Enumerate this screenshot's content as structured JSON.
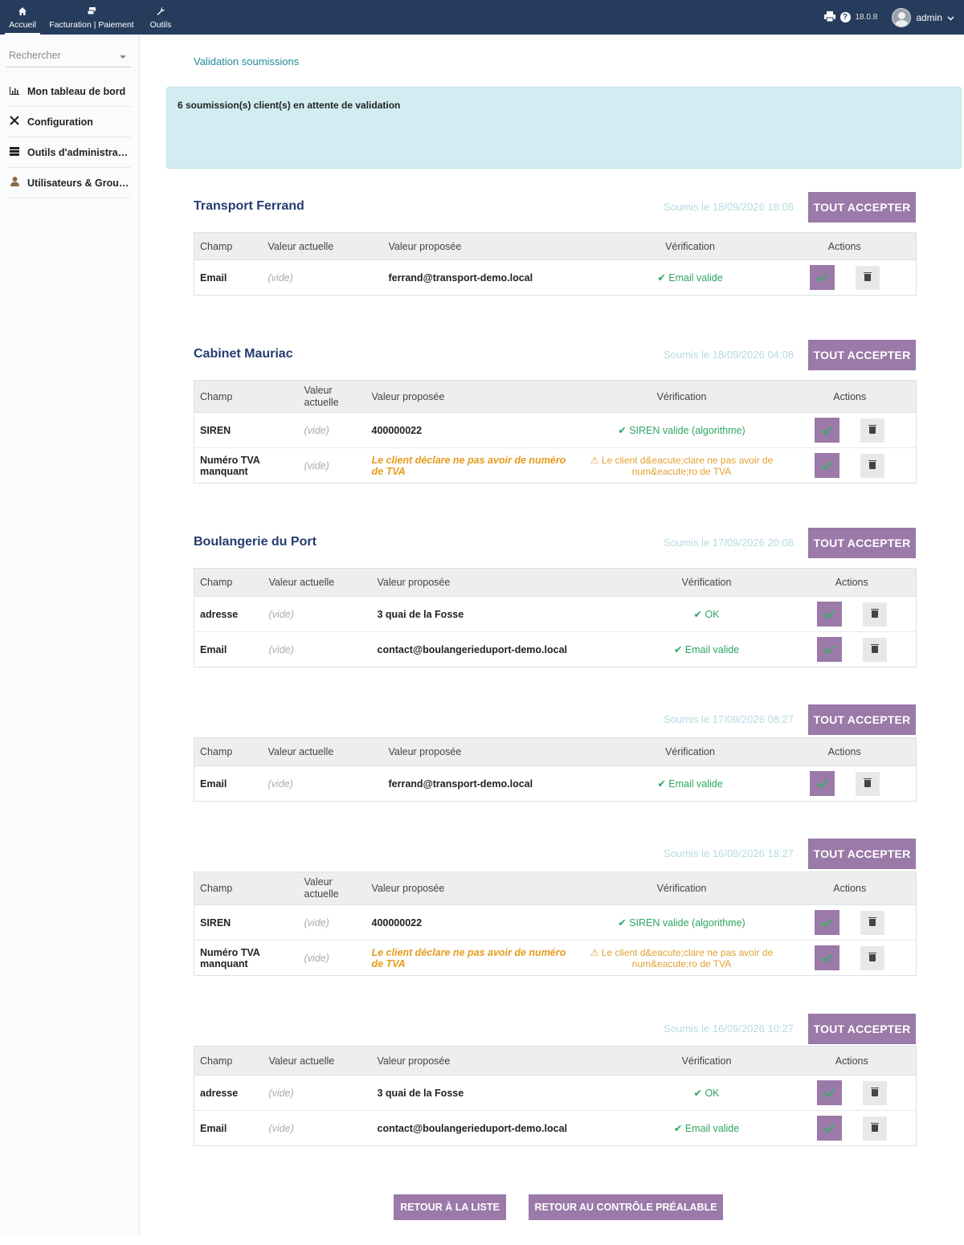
{
  "topbar": {
    "menus": [
      {
        "label": "Accueil",
        "icon": "home-icon"
      },
      {
        "label": "Facturation | Paiement",
        "icon": "billing-icon"
      },
      {
        "label": "Outils",
        "icon": "wrench-icon"
      }
    ],
    "version": "18.0.8",
    "user": "admin"
  },
  "sidebar": {
    "search_placeholder": "Rechercher",
    "items": [
      {
        "label": "Mon tableau de bord",
        "icon": "chart-icon"
      },
      {
        "label": "Configuration",
        "icon": "tools-icon"
      },
      {
        "label": "Outils d'administration",
        "icon": "server-icon"
      },
      {
        "label": "Utilisateurs & Groupes",
        "icon": "user-icon"
      }
    ]
  },
  "breadcrumb": "Validation soumissions",
  "alert": "6 soumission(s) client(s) en attente de validation",
  "accept_all_label": "TOUT ACCEPTER",
  "columns": {
    "field": "Champ",
    "current": "Valeur actuelle",
    "proposed": "Valeur proposée",
    "verification": "Vérification",
    "actions": "Actions"
  },
  "submissions": [
    {
      "title": "Transport Ferrand",
      "date": "Soumis le 18/09/2026 18:08",
      "rows": [
        {
          "field": "Email",
          "current": "(vide)",
          "proposed": "ferrand@transport-demo.local",
          "verification": "Email valide"
        }
      ]
    },
    {
      "title": "Cabinet Mauriac",
      "date": "Soumis le 18/09/2026 04:08",
      "rows": [
        {
          "field": "SIREN",
          "current": "(vide)",
          "proposed": "400000022",
          "verification": "SIREN valide (algorithme)"
        },
        {
          "field": "Numéro TVA manquant",
          "current": "(vide)",
          "proposed": "Le client déclare ne pas avoir de numéro de TVA",
          "verification": "Le client d&eacute;clare ne pas avoir de num&eacute;ro de TVA"
        }
      ]
    },
    {
      "title": "Boulangerie du Port",
      "date": "Soumis le 17/09/2026 20:08",
      "rows": [
        {
          "field": "adresse",
          "current": "(vide)",
          "proposed": "3 quai de la Fosse",
          "verification": "OK"
        },
        {
          "field": "Email",
          "current": "(vide)",
          "proposed": "contact@boulangerieduport-demo.local",
          "verification": "Email valide"
        }
      ]
    },
    {
      "title": "",
      "date": "Soumis le 17/09/2026 08:27",
      "rows": [
        {
          "field": "Email",
          "current": "(vide)",
          "proposed": "ferrand@transport-demo.local",
          "verification": "Email valide"
        }
      ]
    },
    {
      "title": "",
      "date": "Soumis le 16/09/2026 18:27",
      "rows": [
        {
          "field": "SIREN",
          "current": "(vide)",
          "proposed": "400000022",
          "verification": "SIREN valide (algorithme)"
        },
        {
          "field": "Numéro TVA manquant",
          "current": "(vide)",
          "proposed": "Le client déclare ne pas avoir de numéro de TVA",
          "verification": "Le client d&eacute;clare ne pas avoir de num&eacute;ro de TVA"
        }
      ]
    },
    {
      "title": "",
      "date": "Soumis le 16/09/2026 10:27",
      "rows": [
        {
          "field": "adresse",
          "current": "(vide)",
          "proposed": "3 quai de la Fosse",
          "verification": "OK"
        },
        {
          "field": "Email",
          "current": "(vide)",
          "proposed": "contact@boulangerieduport-demo.local",
          "verification": "Email valide"
        }
      ]
    }
  ],
  "footer": {
    "back_to_list": "RETOUR À LA LISTE",
    "back_to_precheck": "RETOUR AU CONTRÔLE PRÉALABLE"
  }
}
